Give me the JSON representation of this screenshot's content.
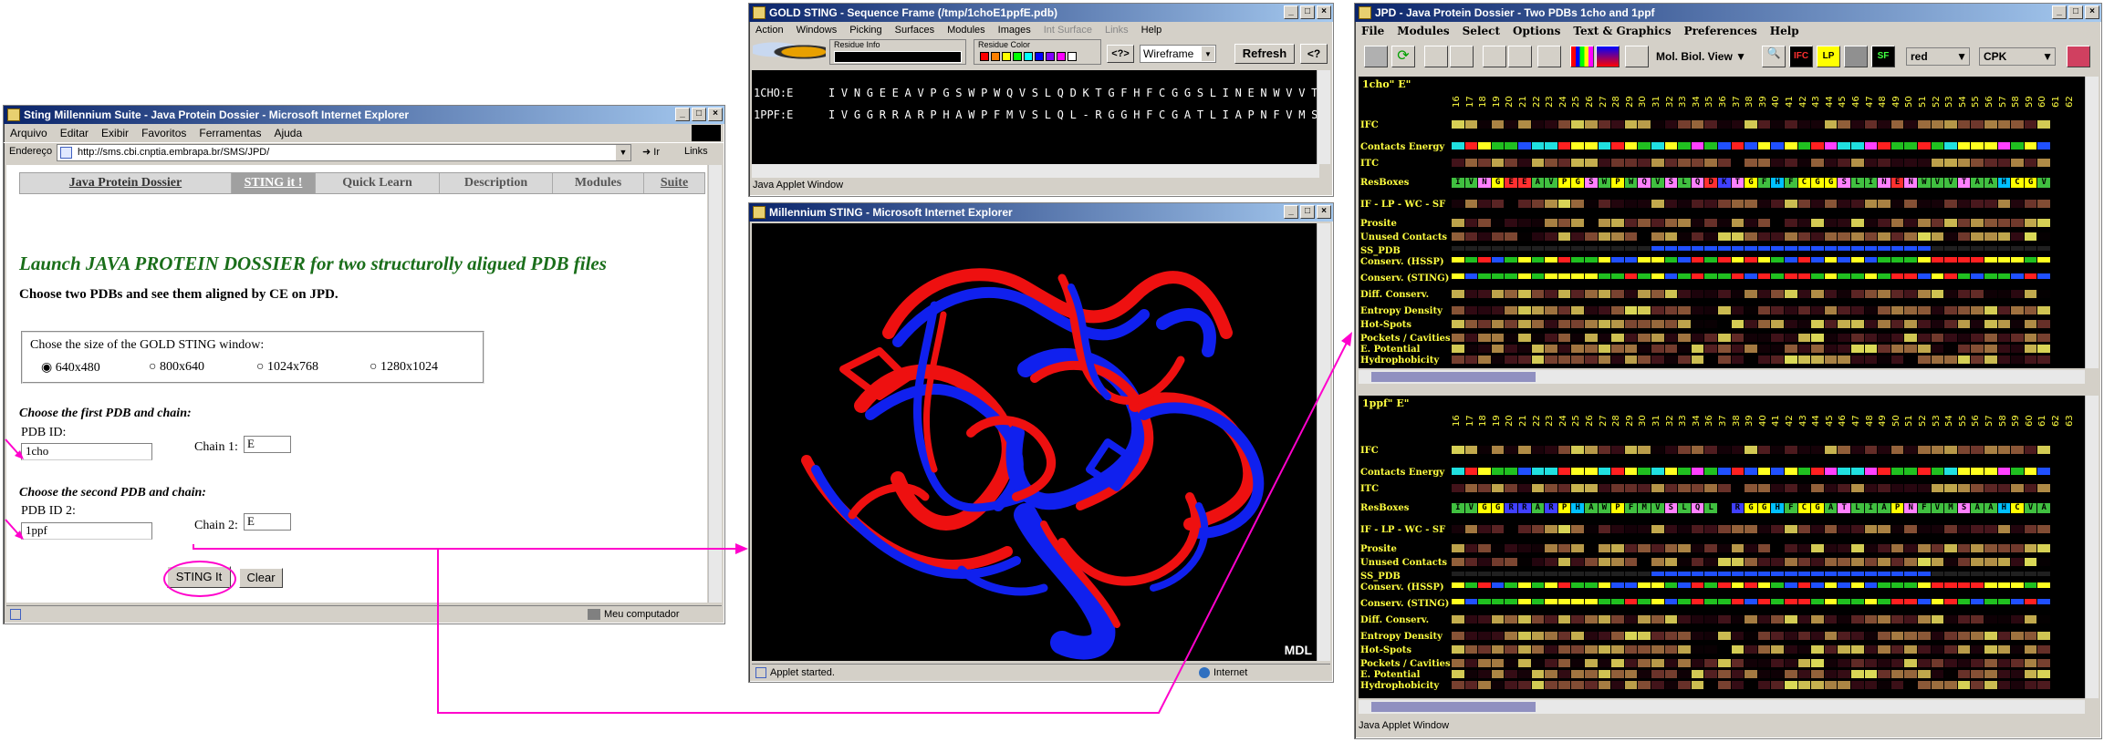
{
  "ie": {
    "title": "Sting Millennium Suite - Java Protein Dossier - Microsoft Internet Explorer",
    "menu": [
      "Arquivo",
      "Editar",
      "Exibir",
      "Favoritos",
      "Ferramentas",
      "Ajuda"
    ],
    "address_label": "Endereço",
    "url": "http://sms.cbi.cnptia.embrapa.br/SMS/JPD/",
    "go": "Ir",
    "links": "Links",
    "tabs": [
      "Java Protein Dossier",
      "STING it !",
      "Quick Learn",
      "Description",
      "Modules",
      "Suite"
    ],
    "heading": "Launch JAVA PROTEIN DOSSIER for two structurolly aligued PDB files",
    "subheading": "Choose two PDBs and see them aligned by CE on JPD.",
    "size_legend": "Chose the size of the GOLD STING window:",
    "sizes": [
      "640x480",
      "800x640",
      "1024x768",
      "1280x1024"
    ],
    "first_title": "Choose the first PDB and chain:",
    "pdb1_label": "PDB ID:",
    "pdb1": "1cho",
    "chain1_label": "Chain 1:",
    "chain1": "E",
    "second_title": "Choose the second PDB and chain:",
    "pdb2_label": "PDB ID 2:",
    "pdb2": "1ppf",
    "chain2_label": "Chain 2:",
    "chain2": "E",
    "sting_btn": "STING It",
    "clear_btn": "Clear",
    "status": "Meu computador"
  },
  "seq": {
    "title": "GOLD STING - Sequence Frame (/tmp/1choE1ppfE.pdb)",
    "menu": [
      "Action",
      "Windows",
      "Picking",
      "Surfaces",
      "Modules",
      "Images",
      "Int Surface",
      "Links",
      "Help"
    ],
    "residue_info": "Residue Info",
    "residue_color": "Residue Color",
    "nav": "<?>",
    "render": "Wireframe",
    "refresh": "Refresh",
    "help": "<?",
    "rows": [
      {
        "name": "1CHO:E",
        "seq": "IVNGEEAVPGSWPWQVSLQDKTGFHFCGGSLINENWVVTAAHCGV"
      },
      {
        "name": "1PPF:E",
        "seq": "IVGGRRARPHAWPFMVSLQL-RGGHFCGATLIAPNFVMSAAHCVA"
      }
    ],
    "applet": "Java Applet Window"
  },
  "ms": {
    "title": "Millennium STING - Microsoft Internet Explorer",
    "mdl": "MDL",
    "status": "Applet started.",
    "zone": "Internet"
  },
  "jpd": {
    "title": "JPD - Java Protein Dossier - Two PDBs 1cho and 1ppf",
    "menu": [
      "File",
      "Modules",
      "Select",
      "Options",
      "Text & Graphics",
      "Preferences",
      "Help"
    ],
    "view": "Mol. Biol. View",
    "color": "red",
    "cpk": "CPK",
    "tb_labels": [
      "IFC",
      "LP",
      "SF"
    ],
    "panel1": "1cho\" E\"",
    "panel2": "1ppf\" E\"",
    "nums1": [
      "16",
      "17",
      "18",
      "19",
      "20",
      "21",
      "22",
      "23",
      "24",
      "25",
      "26",
      "27",
      "28",
      "29",
      "30",
      "31",
      "32",
      "33",
      "34",
      "35",
      "36",
      "37",
      "38",
      "39",
      "40",
      "41",
      "42",
      "43",
      "44",
      "45",
      "46",
      "47",
      "48",
      "49",
      "50",
      "51",
      "52",
      "53",
      "54",
      "55",
      "56",
      "57",
      "58",
      "59",
      "60",
      "61",
      "62"
    ],
    "nums2": [
      "16",
      "17",
      "18",
      "19",
      "20",
      "21",
      "22",
      "23",
      "24",
      "25",
      "26",
      "27",
      "28",
      "29",
      "30",
      "31",
      "32",
      "33",
      "34",
      "36",
      "37",
      "38",
      "39",
      "40",
      "41",
      "42",
      "43",
      "44",
      "45",
      "46",
      "47",
      "48",
      "49",
      "50",
      "51",
      "52",
      "53",
      "54",
      "55",
      "56",
      "57",
      "58",
      "59",
      "60",
      "61",
      "62",
      "63"
    ],
    "labels": [
      "IFC",
      "Contacts Energy",
      "ITC",
      "ResBoxes",
      "IF - LP - WC - SF",
      "Prosite",
      "Unused Contacts",
      "SS_PDB",
      "Conserv. (HSSP)",
      "Conserv. (STING)",
      "Diff. Conserv.",
      "Entropy Density",
      "Hot-Spots",
      "Pockets / Cavities",
      "E. Potential",
      "Hydrophobicity"
    ],
    "seq1": "IVNGEEAVPGSWPWQVSLQDKTGFHFCGGSLINENWVVTAAHCGV",
    "seq2": "IVGGRRARPHAWPFMVSLQL-RGGHFCGATLIAPNFVMSAAHCVA",
    "applet": "Java Applet Window"
  }
}
